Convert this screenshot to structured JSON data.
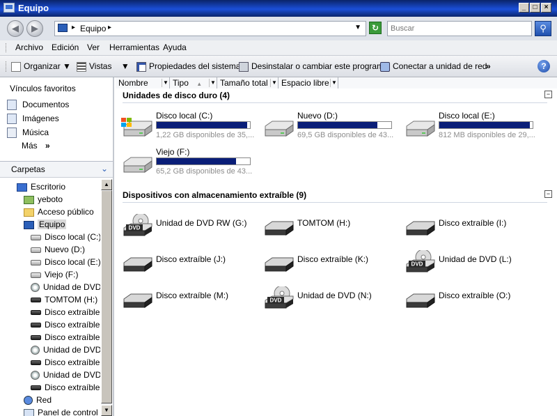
{
  "window": {
    "title": "Equipo"
  },
  "address": {
    "location": "Equipo",
    "search_placeholder": "Buscar"
  },
  "menu": [
    "Archivo",
    "Edición",
    "Ver",
    "Herramientas",
    "Ayuda"
  ],
  "toolbar": {
    "organize": "Organizar",
    "views": "Vistas",
    "properties": "Propiedades del sistema",
    "uninstall": "Desinstalar o cambiar este programa",
    "map_drive": "Conectar a unidad de red",
    "more": "»"
  },
  "favorites": {
    "title": "Vínculos favoritos",
    "items": [
      "Documentos",
      "Imágenes",
      "Música"
    ],
    "more": "Más",
    "more_arrow": "»"
  },
  "folders": {
    "title": "Carpetas",
    "tree": [
      {
        "label": "Escritorio",
        "icon": "desktop-icon",
        "level": 0
      },
      {
        "label": "yeboto",
        "icon": "user-folder-icon",
        "level": 1
      },
      {
        "label": "Acceso público",
        "icon": "folder-icon",
        "level": 1
      },
      {
        "label": "Equipo",
        "icon": "computer-icon",
        "level": 1,
        "selected": true
      },
      {
        "label": "Disco local (C:)",
        "icon": "hard-drive-icon",
        "level": 2
      },
      {
        "label": "Nuevo (D:)",
        "icon": "hard-drive-icon",
        "level": 2
      },
      {
        "label": "Disco local (E:)",
        "icon": "hard-drive-icon",
        "level": 2
      },
      {
        "label": "Viejo (F:)",
        "icon": "hard-drive-icon",
        "level": 2
      },
      {
        "label": "Unidad de DVD",
        "icon": "dvd-drive-icon",
        "level": 2
      },
      {
        "label": "TOMTOM (H:)",
        "icon": "removable-drive-icon",
        "level": 2
      },
      {
        "label": "Disco extraíble (",
        "icon": "removable-drive-icon",
        "level": 2
      },
      {
        "label": "Disco extraíble (",
        "icon": "removable-drive-icon",
        "level": 2
      },
      {
        "label": "Disco extraíble (",
        "icon": "removable-drive-icon",
        "level": 2
      },
      {
        "label": "Unidad de DVD",
        "icon": "dvd-drive-icon",
        "level": 2
      },
      {
        "label": "Disco extraíble (",
        "icon": "removable-drive-icon",
        "level": 2
      },
      {
        "label": "Unidad de DVD",
        "icon": "dvd-drive-icon",
        "level": 2
      },
      {
        "label": "Disco extraíble (",
        "icon": "removable-drive-icon",
        "level": 2
      },
      {
        "label": "Red",
        "icon": "network-icon",
        "level": 1
      },
      {
        "label": "Panel de control",
        "icon": "control-panel-icon",
        "level": 1
      }
    ]
  },
  "columns": [
    "Nombre",
    "Tipo",
    "Tamaño total",
    "Espacio libre"
  ],
  "groups": [
    {
      "title": "Unidades de disco duro (4)",
      "items": [
        {
          "name": "Disco local (C:)",
          "free": "1,22 GB disponibles de 35,...",
          "used_fraction": 0.97,
          "icon": "windows-drive-icon"
        },
        {
          "name": "Nuevo (D:)",
          "free": "69,5 GB disponibles de 43...",
          "used_fraction": 0.85,
          "icon": "hard-drive-icon"
        },
        {
          "name": "Disco local (E:)",
          "free": "812 MB disponibles de 29,...",
          "used_fraction": 0.97,
          "icon": "hard-drive-icon"
        },
        {
          "name": "Viejo (F:)",
          "free": "65,2 GB disponibles de 43...",
          "used_fraction": 0.85,
          "icon": "hard-drive-icon"
        }
      ]
    },
    {
      "title": "Dispositivos con almacenamiento extraíble (9)",
      "items": [
        {
          "name": "Unidad de DVD RW (G:)",
          "icon": "dvd-drive-icon"
        },
        {
          "name": "TOMTOM (H:)",
          "icon": "removable-drive-icon"
        },
        {
          "name": "Disco extraíble (I:)",
          "icon": "removable-drive-icon"
        },
        {
          "name": "Disco extraíble (J:)",
          "icon": "removable-drive-icon"
        },
        {
          "name": "Disco extraíble (K:)",
          "icon": "removable-drive-icon"
        },
        {
          "name": "Unidad de DVD (L:)",
          "icon": "dvd-drive-icon"
        },
        {
          "name": "Disco extraíble (M:)",
          "icon": "removable-drive-icon"
        },
        {
          "name": "Unidad de DVD (N:)",
          "icon": "dvd-drive-icon"
        },
        {
          "name": "Disco extraíble (O:)",
          "icon": "removable-drive-icon"
        }
      ]
    }
  ],
  "dvd_badge": "DVD"
}
